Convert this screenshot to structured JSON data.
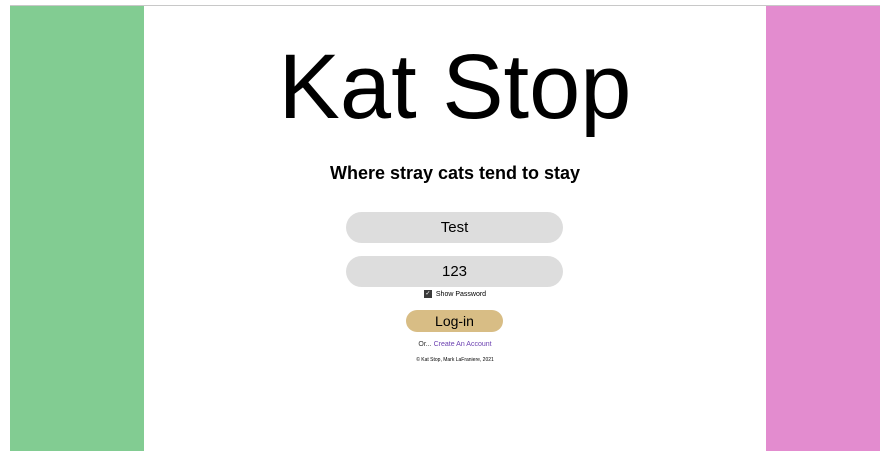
{
  "colors": {
    "left_band": "#82cc92",
    "right_band": "#e38ccf",
    "input_bg": "#dddddd",
    "button_bg": "#d8bd85",
    "link": "#6a3fb0"
  },
  "header": {
    "title": "Kat Stop",
    "tagline": "Where stray cats tend to stay"
  },
  "form": {
    "username_value": "Test",
    "password_value": "123",
    "show_password_label": "Show Password",
    "show_password_checked": true,
    "login_label": "Log-in",
    "or_text": "Or...",
    "create_account_label": "Create An Account"
  },
  "footer": {
    "copyright": "© Kat Stop, Mark LaFraniere, 2021"
  }
}
